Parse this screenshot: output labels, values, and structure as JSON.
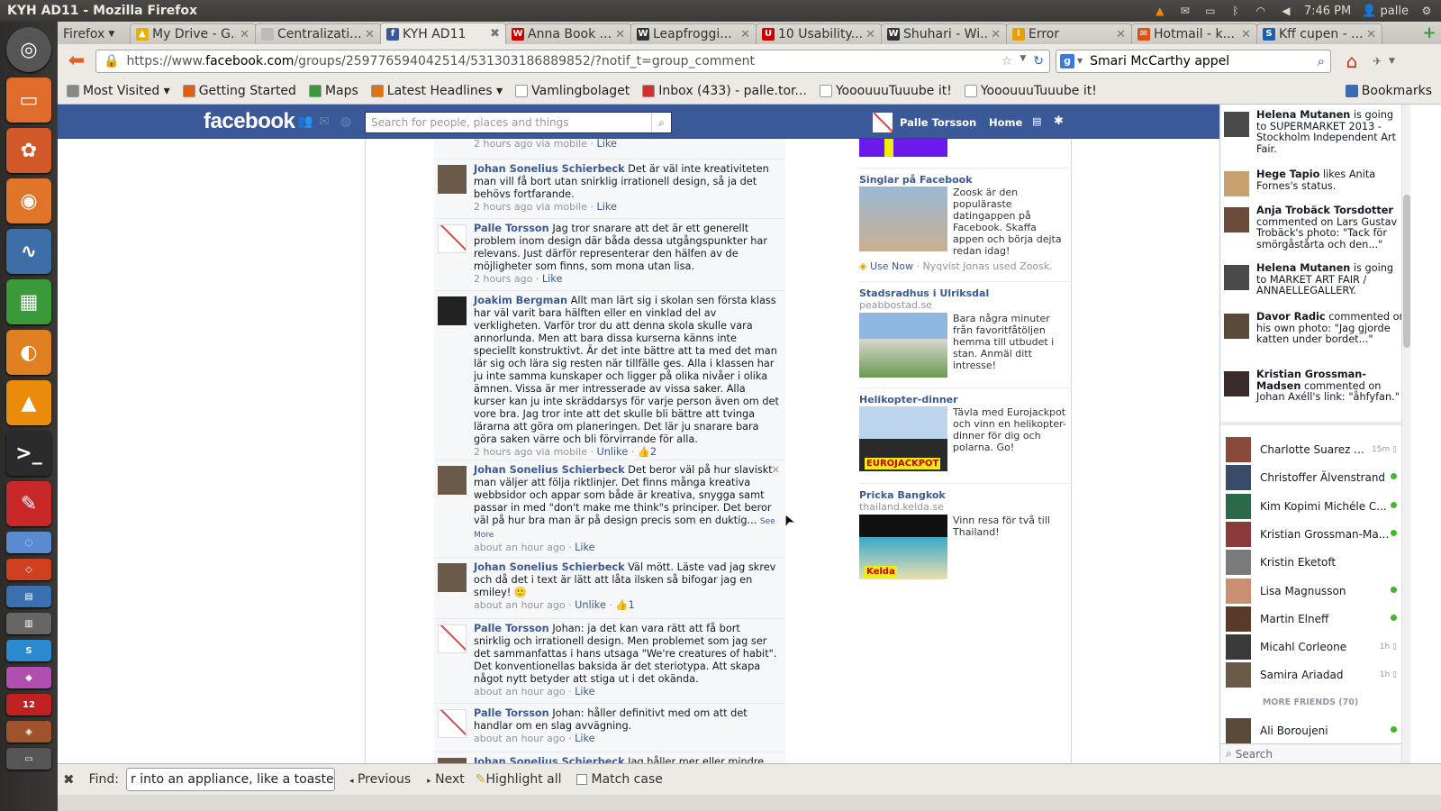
{
  "os": {
    "window_title": "KYH AD11 - Mozilla Firefox",
    "time": "7:46 PM",
    "user": "palle"
  },
  "browser": {
    "menu_label": "Firefox",
    "tabs": [
      {
        "title": "My Drive - G...",
        "color": "#e8b000",
        "glyph": "▲"
      },
      {
        "title": "Centralizati...",
        "color": "#bbb",
        "glyph": ""
      },
      {
        "title": "KYH AD11",
        "color": "#3b5998",
        "glyph": "f",
        "active": true
      },
      {
        "title": "Anna Book ...",
        "color": "#c00",
        "glyph": "W"
      },
      {
        "title": "Leapfroggi...",
        "color": "#333",
        "glyph": "W"
      },
      {
        "title": "10 Usability...",
        "color": "#c00",
        "glyph": "U"
      },
      {
        "title": "Shuhari - Wi...",
        "color": "#333",
        "glyph": "W"
      },
      {
        "title": "Error",
        "color": "#e8a000",
        "glyph": "!"
      },
      {
        "title": "Hotmail - k...",
        "color": "#e05010",
        "glyph": "✉"
      },
      {
        "title": "Kff cupen - ...",
        "color": "#1a5fb4",
        "glyph": "S"
      }
    ],
    "url_prefix": "https://www.",
    "url_domain": "facebook.com",
    "url_rest": "/groups/259776594042514/531303186889852/?notif_t=group_comment",
    "search_value": "Smari McCarthy appel",
    "bookmarks": [
      "Most Visited ▾",
      "Getting Started",
      "Maps",
      "Latest Headlines ▾",
      "Vamlingbolaget",
      "Inbox (433) - palle.tor...",
      "YooouuuTuuube it!",
      "YooouuuTuuube it!"
    ],
    "bookmarks_menu": "Bookmarks"
  },
  "fb": {
    "logo": "facebook",
    "search_placeholder": "Search for people, places and things",
    "user": "Palle Torsson",
    "home": "Home"
  },
  "comments": [
    {
      "top_meta": "2 hours ago via mobile · ",
      "like": "Like"
    },
    {
      "author": "Johan Sonelius Schierbeck",
      "text": " Det är väl inte kreativiteten man vill få bort utan snirklig irrationell design, så ja det behövs fortfarande.",
      "meta": "2 hours ago via mobile · ",
      "like": "Like"
    },
    {
      "author": "Palle Torsson",
      "text": " Jag tror snarare att det är ett generellt problem inom design där båda dessa utgångspunkter har relevans. Just därför representerar den hälfen av de möjligheter som finns, som mona utan lisa.",
      "meta": "2 hours ago · ",
      "like": "Like"
    },
    {
      "author": "Joakim Bergman",
      "text": " Allt man lärt sig i skolan sen första klass har väl varit bara hälften eller en vinklad del av verkligheten. Varför tror du att denna skola skulle vara annorlunda. Men att bara dissa kurserna känns inte speciellt konstruktivt. Är det inte bättre att ta med det man lär sig och lära sig resten när tillfälle ges. Alla i klassen har ju inte samma kunskaper och ligger på olika nivåer i olika ämnen. Vissa är mer intresserade av vissa saker. Alla kurser kan ju inte skräddarsys för varje person även om det vore bra. Jag tror inte att det skulle bli bättre att tvinga lärarna att göra om planeringen. Det lär ju snarare bara göra saken värre och bli förvirrande för alla.",
      "meta": "2 hours ago via mobile · ",
      "like": "Unlike",
      "likes": "2"
    },
    {
      "author": "Johan Sonelius Schierbeck",
      "text": " Det beror väl på hur slaviskt man väljer att följa riktlinjer. Det finns många kreativa webbsidor och appar som både är kreativa, snygga samt passar in med \"don't make me think\"s principer. Det beror väl på hur bra man är på design precis som en duktig...",
      "see_more": "See More",
      "meta": "about an hour ago · ",
      "like": "Like"
    },
    {
      "author": "Johan Sonelius Schierbeck",
      "text": " Väl mött. Läste vad jag skrev och då det i text är lätt att låta ilsken så bifogar jag en smiley! 🙂",
      "meta": "about an hour ago · ",
      "like": "Unlike",
      "likes": "1"
    },
    {
      "author": "Palle Torsson",
      "text": " Johan: ja det kan vara rätt att få bort snirklig och irrationell design. Men problemet som jag ser det sammanfattas i hans utsaga \"We're creatures of habit\". Det konventionellas baksida är det steriotypa. Att skapa något nytt betyder att stiga ut i det okända.",
      "meta": "about an hour ago · ",
      "like": "Like"
    },
    {
      "author": "Palle Torsson",
      "text": " Johan: håller definitivt med om att det handlar om en slag avvägning.",
      "meta": "about an hour ago · ",
      "like": "Like"
    },
    {
      "author": "Johan Sonelius Schierbeck",
      "text": " Jag håller mer eller mindre"
    }
  ],
  "ads": [
    {
      "title": "Singlar på Facebook",
      "url": "",
      "text": "Zoosk är den populäraste datingappen på Facebook. Skaffa appen och börja dejta redan idag!",
      "action": "Use Now",
      "social": " · Nyqvist Jonas used Zoosk."
    },
    {
      "title": "Stadsradhus i Ulriksdal",
      "url": "peabbostad.se",
      "text": "Bara några minuter från favoritfåtöljen hemma till utbudet i stan. Anmäl ditt intresse!"
    },
    {
      "title": "Helikopter-dinner",
      "url": "",
      "text": "Tävla med Eurojackpot och vinn en helikopter-dinner för dig och polarna. Go!",
      "img_label": "EUROJACKPOT"
    },
    {
      "title": "Pricka Bangkok",
      "url": "thailand.kelda.se",
      "text": "Vinn resa för två till Thailand!",
      "img_label": "Kelda"
    }
  ],
  "ticker": [
    {
      "name": "Helena Mutanen",
      "text": " is going to SUPERMARKET 2013 - Stockholm Independent Art Fair."
    },
    {
      "name": "Hege Tapio",
      "text": " likes Anita Fornes's status."
    },
    {
      "name": "Anja Trobäck Torsdotter",
      "text": " commented on Lars Gustav Trobäck's photo: \"Tack för smörgåstårta och den...\""
    },
    {
      "name": "Helena Mutanen",
      "text": " is going to MARKET ART FAIR / ANNAELLEGALLERY."
    },
    {
      "name": "Davor Radic",
      "text": " commented on his own photo: \"Jag gjorde katten under bordet...\""
    },
    {
      "name": "Kristian Grossman-Madsen",
      "text": " commented on Johan Axéll's link: \"åhfyfan.\""
    }
  ],
  "friends": [
    {
      "name": "Charlotte Suarez ...",
      "status": "15m"
    },
    {
      "name": "Christoffer Älvenstrand",
      "status": "online"
    },
    {
      "name": "Kim Kopimi Michéle C...",
      "status": "online"
    },
    {
      "name": "Kristian Grossman-Ma...",
      "status": "online"
    },
    {
      "name": "Kristin Eketoft",
      "status": ""
    },
    {
      "name": "Lisa Magnusson",
      "status": "online"
    },
    {
      "name": "Martin Elneff",
      "status": "online"
    },
    {
      "name": "Micahl Corleone",
      "status": "1h"
    },
    {
      "name": "Samira Ariadad",
      "status": "1h"
    }
  ],
  "more_friends": "MORE FRIENDS (70)",
  "extra_friend": {
    "name": "Ali Boroujeni",
    "status": "online"
  },
  "chat_search": "Search",
  "find": {
    "label": "Find:",
    "value": "r into an appliance, like a toaster, t",
    "previous": "Previous",
    "next": "Next",
    "highlight": "Highlight all",
    "match_case": "Match case"
  }
}
